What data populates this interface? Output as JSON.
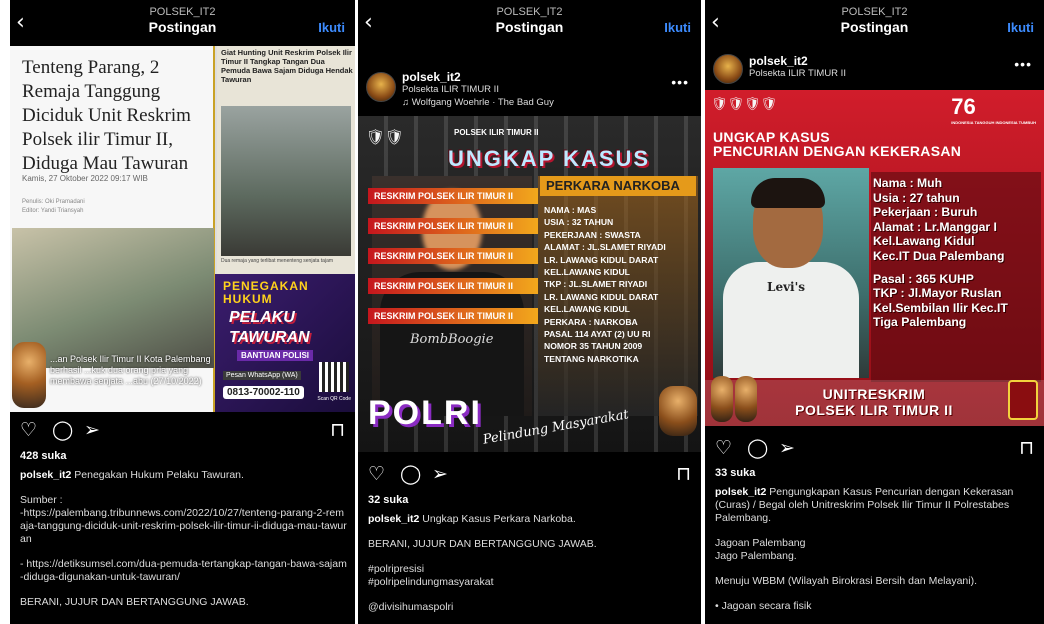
{
  "common": {
    "header_title": "Postingan",
    "follow_label": "Ikuti",
    "back_glyph": "‹"
  },
  "posts": [
    {
      "header_username": "POLSEK_IT2",
      "image": {
        "news_headline": "Tenteng Parang, 2 Remaja Tanggung Diciduk Unit Reskrim Polsek ilir Timur II, Diduga Mau Tawuran",
        "news_date": "Kamis, 27 Oktober 2022 09:17 WIB",
        "news_byline": "Penulis: Oki Pramadani\nEditor: Yandi Triansyah",
        "side_headline": "Giat Hunting Unit Reskrim Polsek Ilir Timur II Tangkap Tangan Dua Pemuda Bawa Sajam Diduga Hendak Tawuran",
        "side_caption": "Dua remaja yang terlibat menenteng senjata tajam",
        "banner_title": "PENEGAKAN HUKUM",
        "banner_sub": "PELAKU TAWURAN",
        "banner_help": "BANTUAN POLISI",
        "banner_wa": "Pesan WhatsApp (WA)",
        "banner_phone": "0813-70002-110",
        "banner_qr": "Scan QR Code",
        "overlay_text": "...an Polsek Ilir Timur II Kota Palembang berhasil ...kuk dua orang pria yang membawa senjata ...abu (27/10/2022)"
      },
      "likes": "428 suka",
      "caption_user": "polsek_it2",
      "caption_text": "Penegakan Hukum Pelaku Tawuran.",
      "caption_rest": [
        "Sumber :\n-https://palembang.tribunnews.com/2022/10/27/tenteng-parang-2-remaja-tanggung-diciduk-unit-reskrim-polsek-ilir-timur-ii-diduga-mau-tawuran",
        "- https://detiksumsel.com/dua-pemuda-tertangkap-tangan-bawa-sajam-diduga-digunakan-untuk-tawuran/",
        "BERANI, JUJUR DAN BERTANGGUNG JAWAB."
      ]
    },
    {
      "header_username": "POLSEK_IT2",
      "author": "polsek_it2",
      "location": "Polsekta ILIR TIMUR II",
      "music": "Wolfgang Woehrle · The Bad Guy",
      "image": {
        "sub": "POLSEK ILIR TIMUR II",
        "title": "UNGKAP KASUS",
        "side_label": "RESKRIM POLSEK ILIR TIMUR II",
        "case_title": "PERKARA NARKOBA",
        "details": [
          "NAMA : MAS",
          "USIA    : 32 TAHUN",
          "PEKERJAAN : SWASTA",
          "ALAMAT : JL.SLAMET RIYADI",
          "LR. LAWANG KIDUL DARAT",
          "KEL.LAWANG KIDUL",
          "TKP : JL.SLAMET RIYADI",
          "LR. LAWANG KIDUL DARAT",
          "KEL.LAWANG KIDUL",
          "PERKARA : NARKOBA",
          "PASAL 114 AYAT (2) UU RI",
          "NOMOR 35 TAHUN 2009",
          "TENTANG NARKOTIKA"
        ],
        "shirt_text": "BombBoogie",
        "polri": "POLRI",
        "motto": "Pelindung Masyarakat"
      },
      "likes": "32 suka",
      "caption_user": "polsek_it2",
      "caption_text": "Ungkap Kasus Perkara Narkoba.",
      "caption_rest": [
        "BERANI, JUJUR DAN BERTANGGUNG JAWAB.",
        "#polripresisi\n#polripelindungmasyarakat",
        "@divisihumaspolri"
      ]
    },
    {
      "header_username": "POLSEK_IT2",
      "author": "polsek_it2",
      "location": "Polsekta ILIR TIMUR II",
      "image": {
        "anniversary": "76",
        "anniversary_sub": "INDONESIA TANGGUH INDONESIA TUMBUH",
        "title": "UNGKAP KASUS\nPENCURIAN DENGAN KEKERASAN",
        "details": [
          "Nama : Muh",
          "Usia : 27 tahun",
          "Pekerjaan : Buruh",
          "Alamat : Lr.Manggar I",
          "Kel.Lawang Kidul",
          "Kec.IT Dua Palembang",
          "",
          "Pasal : 365 KUHP",
          "TKP : Jl.Mayor Ruslan",
          "Kel.Sembilan Ilir Kec.IT",
          "Tiga Palembang"
        ],
        "shirt_text": "Levi's",
        "unit": "UNITRESKRIM\nPOLSEK ILIR TIMUR II"
      },
      "likes": "33 suka",
      "caption_user": "polsek_it2",
      "caption_text": "Pengungkapan Kasus Pencurian dengan Kekerasan (Curas) / Begal oleh Unitreskrim Polsek Ilir Timur II Polrestabes Palembang.",
      "caption_rest": [
        "Jagoan Palembang\nJago Palembang.",
        "Menuju WBBM (Wilayah Birokrasi Bersih dan Melayani).",
        "• Jagoan secara fisik"
      ]
    }
  ],
  "icons": {
    "heart": "heart-icon",
    "comment": "comment-icon",
    "share": "share-icon",
    "save": "bookmark-icon"
  },
  "colors": {
    "background": "#000000",
    "follow": "#3d8bfd",
    "text": "#ffffff"
  }
}
